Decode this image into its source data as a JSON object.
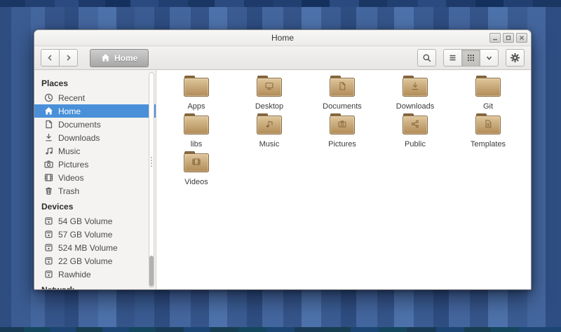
{
  "window": {
    "title": "Home",
    "controls": [
      {
        "name": "minimize"
      },
      {
        "name": "maximize"
      },
      {
        "name": "close"
      }
    ]
  },
  "toolbar": {
    "location_label": "Home",
    "buttons": {
      "back": "back",
      "forward": "forward",
      "search": "search",
      "list_view": "list-view",
      "grid_view": "grid-view",
      "view_options": "view-options",
      "settings": "settings"
    },
    "active_view": "grid"
  },
  "sidebar": {
    "sections": [
      {
        "header": "Places",
        "items": [
          {
            "icon": "clock",
            "label": "Recent",
            "selected": false
          },
          {
            "icon": "home",
            "label": "Home",
            "selected": true
          },
          {
            "icon": "document",
            "label": "Documents",
            "selected": false
          },
          {
            "icon": "download",
            "label": "Downloads",
            "selected": false
          },
          {
            "icon": "music",
            "label": "Music",
            "selected": false
          },
          {
            "icon": "camera",
            "label": "Pictures",
            "selected": false
          },
          {
            "icon": "film",
            "label": "Videos",
            "selected": false
          },
          {
            "icon": "trash",
            "label": "Trash",
            "selected": false
          }
        ]
      },
      {
        "header": "Devices",
        "items": [
          {
            "icon": "drive",
            "label": "54 GB Volume",
            "selected": false
          },
          {
            "icon": "drive",
            "label": "57 GB Volume",
            "selected": false
          },
          {
            "icon": "drive",
            "label": "524 MB Volume",
            "selected": false
          },
          {
            "icon": "drive",
            "label": "22 GB Volume",
            "selected": false
          },
          {
            "icon": "drive",
            "label": "Rawhide",
            "selected": false
          }
        ]
      },
      {
        "header": "Network",
        "items": []
      }
    ]
  },
  "files": {
    "folders": [
      {
        "name": "Apps",
        "emblem": "none"
      },
      {
        "name": "Desktop",
        "emblem": "desktop"
      },
      {
        "name": "Documents",
        "emblem": "document"
      },
      {
        "name": "Downloads",
        "emblem": "download"
      },
      {
        "name": "Git",
        "emblem": "none"
      },
      {
        "name": "libs",
        "emblem": "none"
      },
      {
        "name": "Music",
        "emblem": "music"
      },
      {
        "name": "Pictures",
        "emblem": "camera"
      },
      {
        "name": "Public",
        "emblem": "share"
      },
      {
        "name": "Templates",
        "emblem": "template"
      },
      {
        "name": "Videos",
        "emblem": "film"
      }
    ]
  },
  "colors": {
    "selection": "#4a90d9",
    "folder_body_light": "#dfc79c",
    "folder_body_dark": "#b08a55",
    "folder_tab": "#8b6a41"
  }
}
